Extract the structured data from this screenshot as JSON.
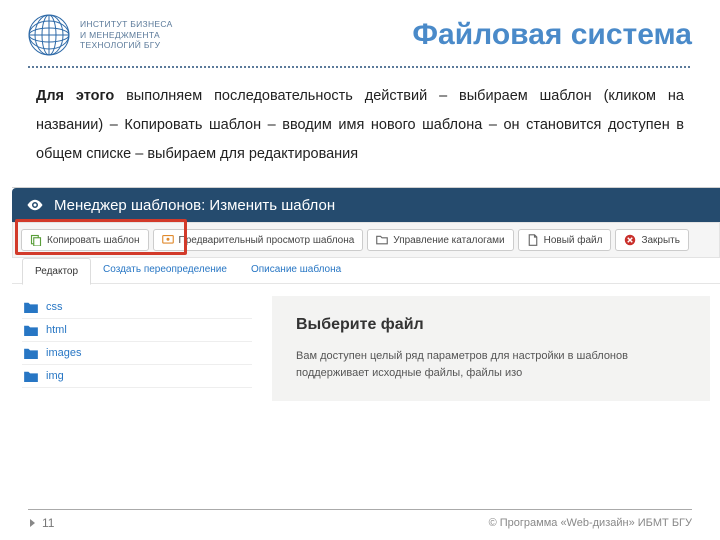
{
  "header": {
    "institute_line1": "ИНСТИТУТ БИЗНЕСА",
    "institute_line2": "И МЕНЕДЖМЕНТА",
    "institute_line3": "ТЕХНОЛОГИЙ БГУ",
    "title": "Файловая система"
  },
  "body": {
    "strong": "Для этого",
    "rest": " выполняем последовательность действий – выбираем шаблон (кликом на названии) – Копировать шаблон – вводим имя нового шаблона – он становится доступен в общем списке – выбираем для редактирования"
  },
  "app": {
    "titlebar": "Менеджер шаблонов: Изменить шаблон",
    "toolbar": {
      "copy": "Копировать шаблон",
      "preview": "Предварительный просмотр шаблона",
      "manage": "Управление каталогами",
      "newfile": "Новый файл",
      "close": "Закрыть"
    },
    "tabs": {
      "editor": "Редактор",
      "override": "Создать переопределение",
      "desc": "Описание шаблона"
    },
    "folders": [
      "css",
      "html",
      "images",
      "img"
    ],
    "panel": {
      "heading": "Выберите файл",
      "text": "Вам доступен целый ряд параметров для настройки в шаблонов поддерживает исходные файлы, файлы изо"
    }
  },
  "footer": {
    "page": "11",
    "copyright": "© Программа «Web-дизайн» ИБМТ БГУ"
  }
}
